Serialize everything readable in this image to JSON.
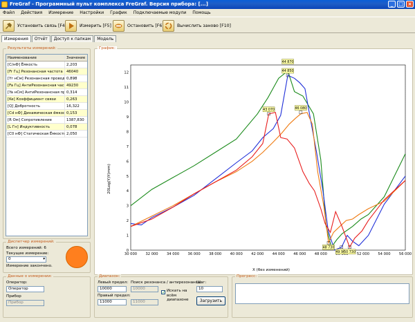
{
  "window": {
    "title": "FreGraf - Программный пульт комплекса FreGraf. Версия прибора: [...]"
  },
  "menu": [
    "Файл",
    "Действия",
    "Измерение",
    "Настройки",
    "График",
    "Подключаемые модули",
    "Помощь"
  ],
  "toolbar": {
    "connect": "Установить связь [F4]",
    "measure": "Измерить [F5]",
    "stop": "Остановить [F6]",
    "recalc": "Вычислить заново [F10]"
  },
  "tabs": [
    "Измерения",
    "Отчёт",
    "Доступ к папкам",
    "Модель"
  ],
  "results": {
    "title": "Результаты измерений:",
    "headers": [
      "Наименование",
      "Значение"
    ],
    "rows": [
      {
        "name": "[C/нФ] Ёмкость",
        "value": "2,203"
      },
      {
        "name": "[Fr Гц] Резонансная частота",
        "value": "46040"
      },
      {
        "name": "[Yr нСм] Резонансная проводимость",
        "value": "0,898"
      },
      {
        "name": "[Fa Гц] АнтиРезонансная частота",
        "value": "49230"
      },
      {
        "name": "[Ya нСм] АнтиРезонансная проводимость",
        "value": "0,314"
      },
      {
        "name": "[Ke] Коэффициент связи",
        "value": "0,263"
      },
      {
        "name": "[Q] Добротность",
        "value": "16,322"
      },
      {
        "name": "[Cd нФ] Динамическая ёмкость",
        "value": "0,153"
      },
      {
        "name": "[R Ом] Сопротивление",
        "value": "1387,830"
      },
      {
        "name": "[L Гн] Индуктивность",
        "value": "0,078"
      },
      {
        "name": "[C0 нФ] Статическая Ёмкость",
        "value": "2,050"
      }
    ]
  },
  "dispatcher": {
    "title": "Диспетчер измерений:",
    "total_label": "Всего измерений:",
    "total_value": "6",
    "current_label": "Текущее измерение:",
    "current_value": "0",
    "auto_label": "Измерение закончено."
  },
  "measurement_data": {
    "title": "Данные о измерении:",
    "operator_label": "Оператор:",
    "operator_value": "Оператор",
    "device_label": "Прибор",
    "device_value": "Прибор"
  },
  "range": {
    "title": "Диапазон:",
    "left_label": "Левый предел:",
    "left_value": "10000",
    "right_label": "Правый предел:",
    "right_value": "11000",
    "search_label": "Поиск резонанса / антирезонанса:",
    "search_from": "10000",
    "search_to": "11000",
    "search_in_range": "Искать на всём диапазоне",
    "step_label": "Шаг:",
    "step_value": "10",
    "load_button": "Загрузить"
  },
  "progress": {
    "title": "Прогресс:"
  },
  "chart_data": {
    "type": "line",
    "title": "График:",
    "xlabel": "X (без изменений)",
    "ylabel": "20Log(Y)Y(mm)",
    "xlim": [
      30000,
      56000
    ],
    "ylim": [
      0,
      12.5
    ],
    "xticks": [
      "30 000",
      "32 000",
      "34 000",
      "36 000",
      "38 000",
      "40 000",
      "42 000",
      "44 000",
      "46 000",
      "48 000",
      "50 000",
      "52 000",
      "54 000",
      "56 000"
    ],
    "yticks": [
      "0",
      "1",
      "2",
      "3",
      "4",
      "5",
      "6",
      "7",
      "8",
      "9",
      "10",
      "11",
      "12"
    ],
    "grid": true,
    "series": [
      {
        "color": "#1a8a1a",
        "x": [
          30000,
          32000,
          34000,
          36000,
          38000,
          40000,
          42000,
          43000,
          44000,
          44870,
          45500,
          46300,
          47300,
          48000,
          48500,
          49000,
          49500,
          50000,
          51000,
          51800,
          52500,
          54000,
          56000
        ],
        "y": [
          3.0,
          4.1,
          4.9,
          5.7,
          6.6,
          7.5,
          9.2,
          10.3,
          11.6,
          12.1,
          10.7,
          10.4,
          9.2,
          6.1,
          1.6,
          0.2,
          0.7,
          1.1,
          1.6,
          2.1,
          2.4,
          3.6,
          6.5
        ]
      },
      {
        "color": "#1f2fd8",
        "x": [
          30000,
          31000,
          32000,
          34000,
          36000,
          38000,
          40000,
          41500,
          42500,
          43500,
          44200,
          44870,
          45500,
          46000,
          46500,
          47000,
          47600,
          48200,
          48700,
          49300,
          49960,
          50500,
          51000,
          51600,
          52500,
          54000,
          56000
        ],
        "y": [
          1.8,
          1.7,
          2.2,
          2.9,
          3.7,
          4.8,
          5.9,
          6.7,
          7.6,
          8.2,
          9.1,
          11.8,
          11.6,
          11.3,
          10.9,
          8.9,
          6.6,
          4.0,
          1.3,
          0.0,
          0.2,
          1.0,
          0.6,
          0.3,
          1.0,
          3.1,
          5.0
        ]
      },
      {
        "color": "#ef7a10",
        "x": [
          30000,
          32000,
          34000,
          36000,
          38000,
          40000,
          41500,
          42500,
          43500,
          44300,
          45000,
          45600,
          46100,
          46700,
          47200,
          47700,
          48300,
          48730,
          49200,
          49800,
          50400,
          51000,
          51600,
          52500,
          54000,
          56000
        ],
        "y": [
          1.6,
          2.3,
          3.0,
          3.8,
          4.6,
          5.3,
          6.0,
          6.6,
          7.3,
          7.9,
          8.5,
          8.9,
          9.2,
          9.3,
          8.5,
          5.3,
          2.9,
          0.5,
          1.2,
          1.6,
          2.0,
          2.1,
          2.4,
          2.8,
          3.3,
          4.7
        ]
      },
      {
        "color": "#e81c1c",
        "x": [
          30000,
          32000,
          34000,
          36000,
          38000,
          40000,
          41500,
          42500,
          43070,
          43700,
          44200,
          44800,
          45500,
          46300,
          46900,
          47400,
          48000,
          48400,
          48900,
          49400,
          50000,
          50730,
          51200,
          51900,
          52500,
          54000,
          56000
        ],
        "y": [
          1.6,
          2.1,
          2.9,
          3.8,
          4.6,
          5.4,
          6.3,
          7.2,
          9.2,
          9.3,
          7.6,
          7.5,
          6.9,
          5.3,
          4.5,
          4.0,
          2.8,
          1.8,
          1.2,
          2.6,
          1.6,
          0.2,
          0.8,
          1.3,
          2.0,
          3.4,
          4.7
        ]
      }
    ],
    "annotations": [
      {
        "text": "44 870",
        "x": 44870,
        "y": 12.1
      },
      {
        "text": "44 850",
        "x": 44870,
        "y": 11.8
      },
      {
        "text": "43 070",
        "x": 43070,
        "y": 9.2
      },
      {
        "text": "46 080",
        "x": 46100,
        "y": 9.3
      },
      {
        "text": "48 730",
        "x": 48730,
        "y": 0.5
      },
      {
        "text": "49 960",
        "x": 49960,
        "y": 0.2
      },
      {
        "text": "50 730",
        "x": 50730,
        "y": 0.2
      }
    ]
  }
}
